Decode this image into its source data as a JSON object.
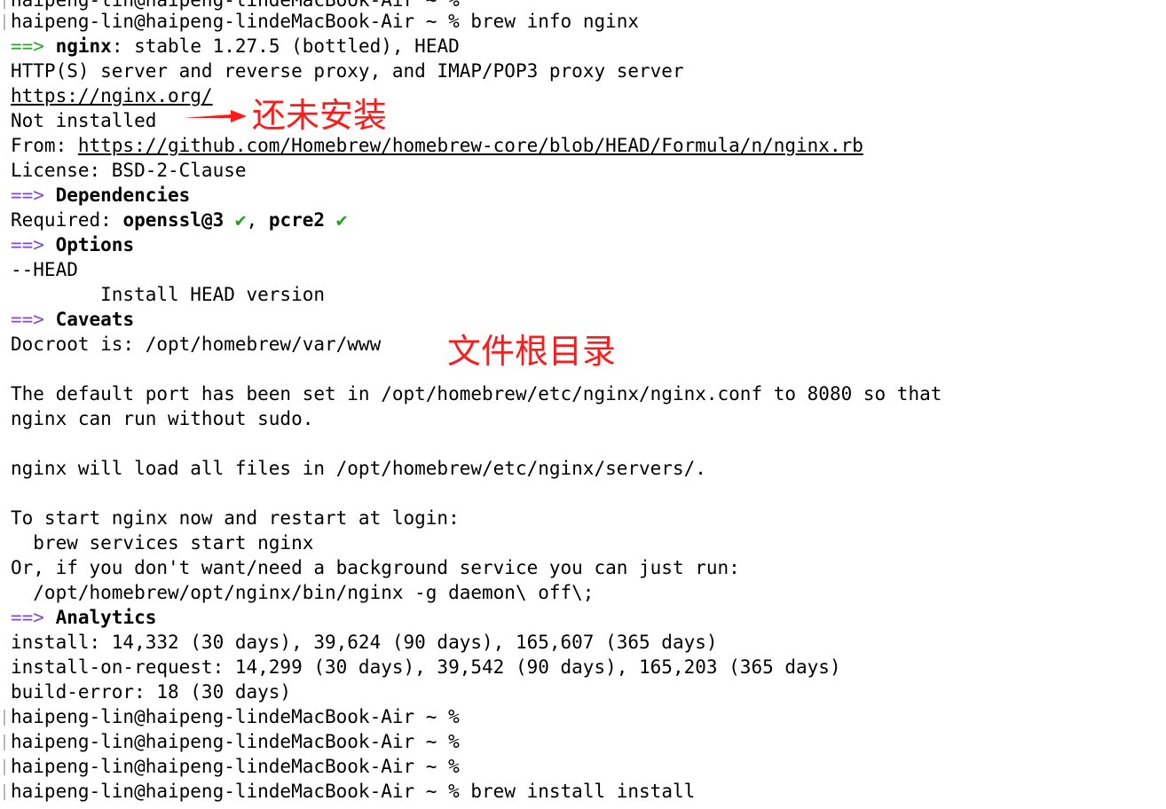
{
  "prompt": {
    "top_partial": "haipeng-lin@haipeng-lindeMacBook-Air ~ %",
    "host": "haipeng-lin@haipeng-lindeMacBook-Air ~ %",
    "command": "brew info nginx",
    "last_command": "brew install install"
  },
  "info": {
    "arrow": "==>",
    "name": "nginx",
    "version_text": ": stable 1.27.5 (bottled), HEAD",
    "description": "HTTP(S) server and reverse proxy, and IMAP/POP3 proxy server",
    "homepage": "https://nginx.org/",
    "install_status": "Not installed",
    "from_label": "From: ",
    "from_url": "https://github.com/Homebrew/homebrew-core/blob/HEAD/Formula/n/nginx.rb",
    "license": "License: BSD-2-Clause"
  },
  "dependencies": {
    "heading": "Dependencies",
    "required_label": "Required: ",
    "dep1": "openssl@3",
    "dep2": "pcre2",
    "check": "✔",
    "sep": ", "
  },
  "options": {
    "heading": "Options",
    "flag": "--HEAD",
    "flag_desc": "        Install HEAD version"
  },
  "caveats": {
    "heading": "Caveats",
    "docroot": "Docroot is: /opt/homebrew/var/www",
    "port_line1": "The default port has been set in /opt/homebrew/etc/nginx/nginx.conf to 8080 so that",
    "port_line2": "nginx can run without sudo.",
    "servers_line": "nginx will load all files in /opt/homebrew/etc/nginx/servers/.",
    "start_line": "To start nginx now and restart at login:",
    "start_cmd": "  brew services start nginx",
    "or_line": "Or, if you don't want/need a background service you can just run:",
    "run_cmd": "  /opt/homebrew/opt/nginx/bin/nginx -g daemon\\ off\\;"
  },
  "analytics": {
    "heading": "Analytics",
    "install": "install: 14,332 (30 days), 39,624 (90 days), 165,607 (365 days)",
    "install_on_request": "install-on-request: 14,299 (30 days), 39,542 (90 days), 165,203 (365 days)",
    "build_error": "build-error: 18 (30 days)"
  },
  "annotations": {
    "not_installed": "还未安装",
    "docroot": "文件根目录"
  },
  "colors": {
    "arrow_purple": "#7b4bd8",
    "arrow_green": "#2aa52a",
    "check_green": "#1f9e1f",
    "annotation_red": "#ff1a1a"
  }
}
